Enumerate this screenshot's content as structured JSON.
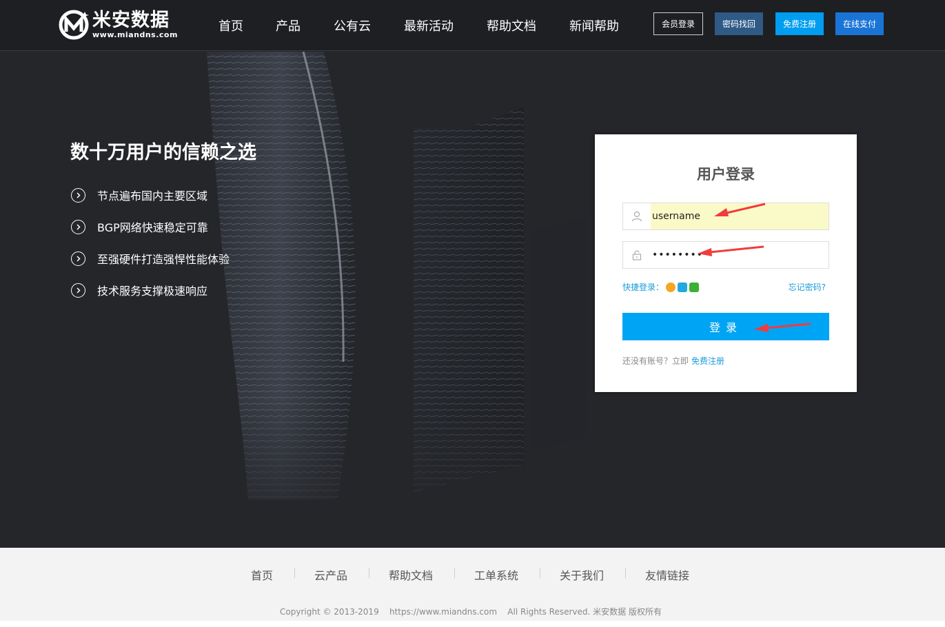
{
  "header": {
    "logo_name": "米安数据",
    "logo_url": "www.miandns.com",
    "nav": [
      "首页",
      "产品",
      "公有云",
      "最新活动",
      "帮助文档",
      "新闻帮助"
    ],
    "buttons": {
      "login": "会员登录",
      "recover": "密码找回",
      "register": "免费注册",
      "pay": "在线支付"
    }
  },
  "hero": {
    "title": "数十万用户的信赖之选",
    "features": [
      "节点遍布国内主要区域",
      "BGP网络快速稳定可靠",
      "至强硬件打造强悍性能体验",
      "技术服务支撑极速响应"
    ]
  },
  "login": {
    "title": "用户登录",
    "username_value": "username",
    "password_value": "••••••••",
    "quick_login_label": "快捷登录：",
    "forgot_label": "忘记密码?",
    "submit_label": "登录",
    "signup_prefix": "还没有账号？立即",
    "signup_link": "免费注册"
  },
  "footer": {
    "links": [
      "首页",
      "云产品",
      "帮助文档",
      "工单系统",
      "关于我们",
      "友情链接"
    ],
    "copyright": "Copyright © 2013-2019    https://www.miandns.com    All Rights Reserved. 米安数据 版权所有"
  },
  "icons": {
    "quick_login": [
      "weibo-icon",
      "qq-icon",
      "wechat-icon"
    ]
  },
  "colors": {
    "primary_blue": "#00a4f4",
    "link_blue": "#1a9cdc",
    "annotation_red": "#f03c3c"
  }
}
